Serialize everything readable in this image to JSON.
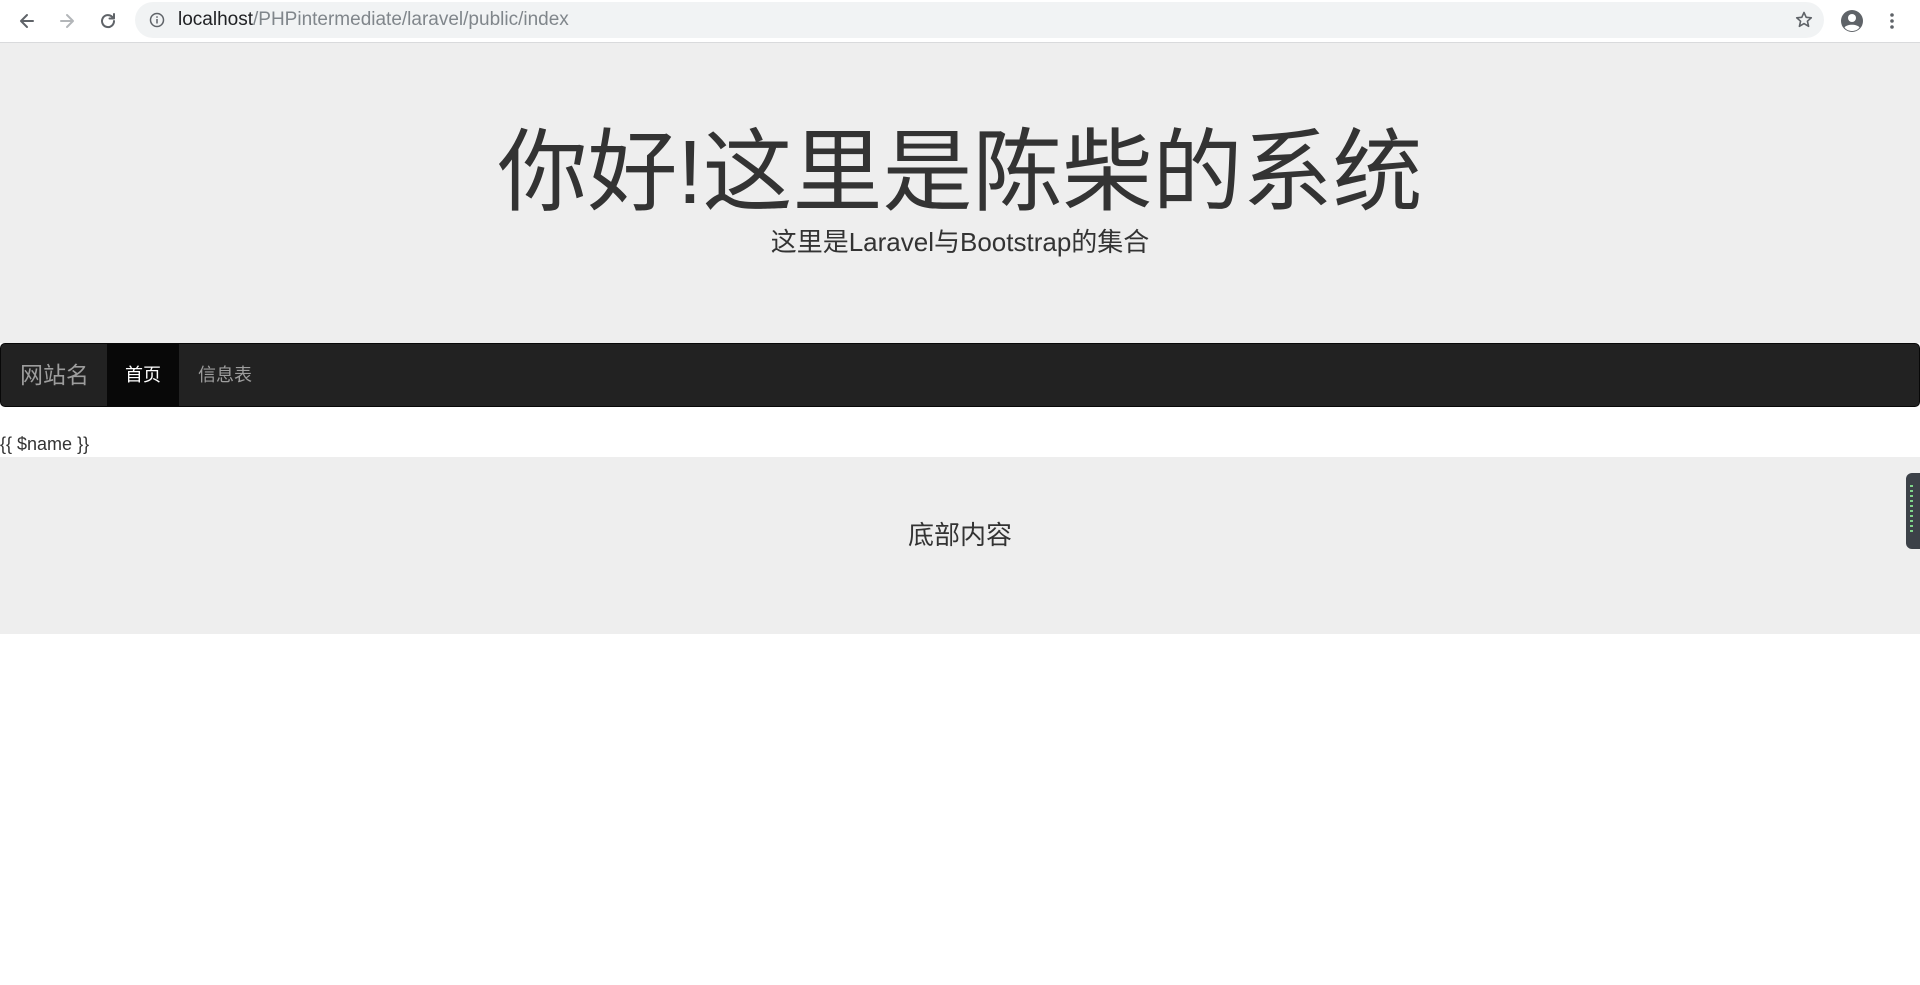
{
  "browser": {
    "url_host": "localhost",
    "url_path": "/PHPintermediate/laravel/public/index",
    "icons": {
      "back": "arrow-left-icon",
      "forward": "arrow-right-icon",
      "reload": "reload-icon",
      "info": "info-icon",
      "bookmark": "star-icon",
      "account": "account-icon",
      "menu": "more-vert-icon"
    }
  },
  "jumbotron": {
    "title": "你好!这里是陈柴的系统",
    "subtitle": "这里是Laravel与Bootstrap的集合"
  },
  "navbar": {
    "brand": "网站名",
    "items": [
      {
        "label": "首页",
        "active": true
      },
      {
        "label": "信息表",
        "active": false
      }
    ]
  },
  "content": {
    "name_placeholder": "{{ $name }}"
  },
  "footer": {
    "text": "底部内容"
  },
  "colors": {
    "jumbotron_bg": "#eeeeee",
    "navbar_bg": "#222222",
    "navbar_active_bg": "#080808",
    "text": "#333333"
  }
}
